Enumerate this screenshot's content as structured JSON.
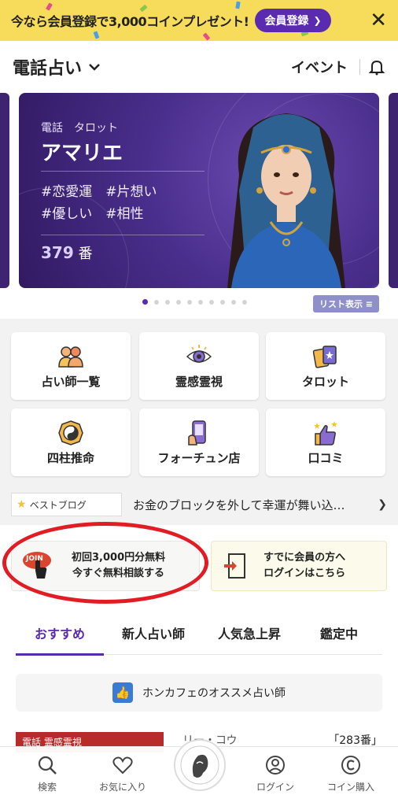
{
  "promo": {
    "text": "今なら会員登録で3,000コインプレゼント!",
    "button": "会員登録",
    "close": "✕"
  },
  "header": {
    "title": "電話占い",
    "event": "イベント"
  },
  "carousel": {
    "category": "電話　タロット",
    "name": "アマリエ",
    "tags_line1": "#恋愛運　#片想い",
    "tags_line2": "#優しい　#相性",
    "number_value": "379",
    "number_suffix": "番",
    "dots_total": 10,
    "active_dot": 0,
    "list_button": "リスト表示 ≡"
  },
  "menu": [
    {
      "label": "占い師一覧",
      "icon": "people-icon"
    },
    {
      "label": "霊感霊視",
      "icon": "eye-icon"
    },
    {
      "label": "タロット",
      "icon": "tarot-cards-icon"
    },
    {
      "label": "四柱推命",
      "icon": "yin-yang-icon"
    },
    {
      "label": "フォーチュン店",
      "icon": "phone-hand-icon"
    },
    {
      "label": "口コミ",
      "icon": "thumbs-up-stars-icon"
    }
  ],
  "blog": {
    "tag": "ベストブログ",
    "text": "お金のブロックを外して幸運が舞い込…"
  },
  "join": {
    "line1": "初回3,000円分無料",
    "line2": "今すぐ無料相談する",
    "badge": "JOIN"
  },
  "login": {
    "line1": "すでに会員の方へ",
    "line2": "ログインはこちら"
  },
  "tabs": [
    "おすすめ",
    "新人占い師",
    "人気急上昇",
    "鑑定中"
  ],
  "recommend": {
    "text": "ホンカフェのオススメ占い師"
  },
  "item": {
    "category": "電話 霊感霊視",
    "name": "リー・コウ",
    "number": "「283番」"
  },
  "bottom_nav": [
    {
      "label": "検索",
      "icon": "search-icon"
    },
    {
      "label": "お気に入り",
      "icon": "heart-icon"
    },
    {
      "label": "",
      "icon": "logo-icon"
    },
    {
      "label": "ログイン",
      "icon": "user-icon"
    },
    {
      "label": "コイン購入",
      "icon": "coin-icon"
    }
  ],
  "colors": {
    "accent": "#5a2bb0",
    "promo_bg": "#f6dc5a",
    "annotation_red": "#e21c24"
  }
}
